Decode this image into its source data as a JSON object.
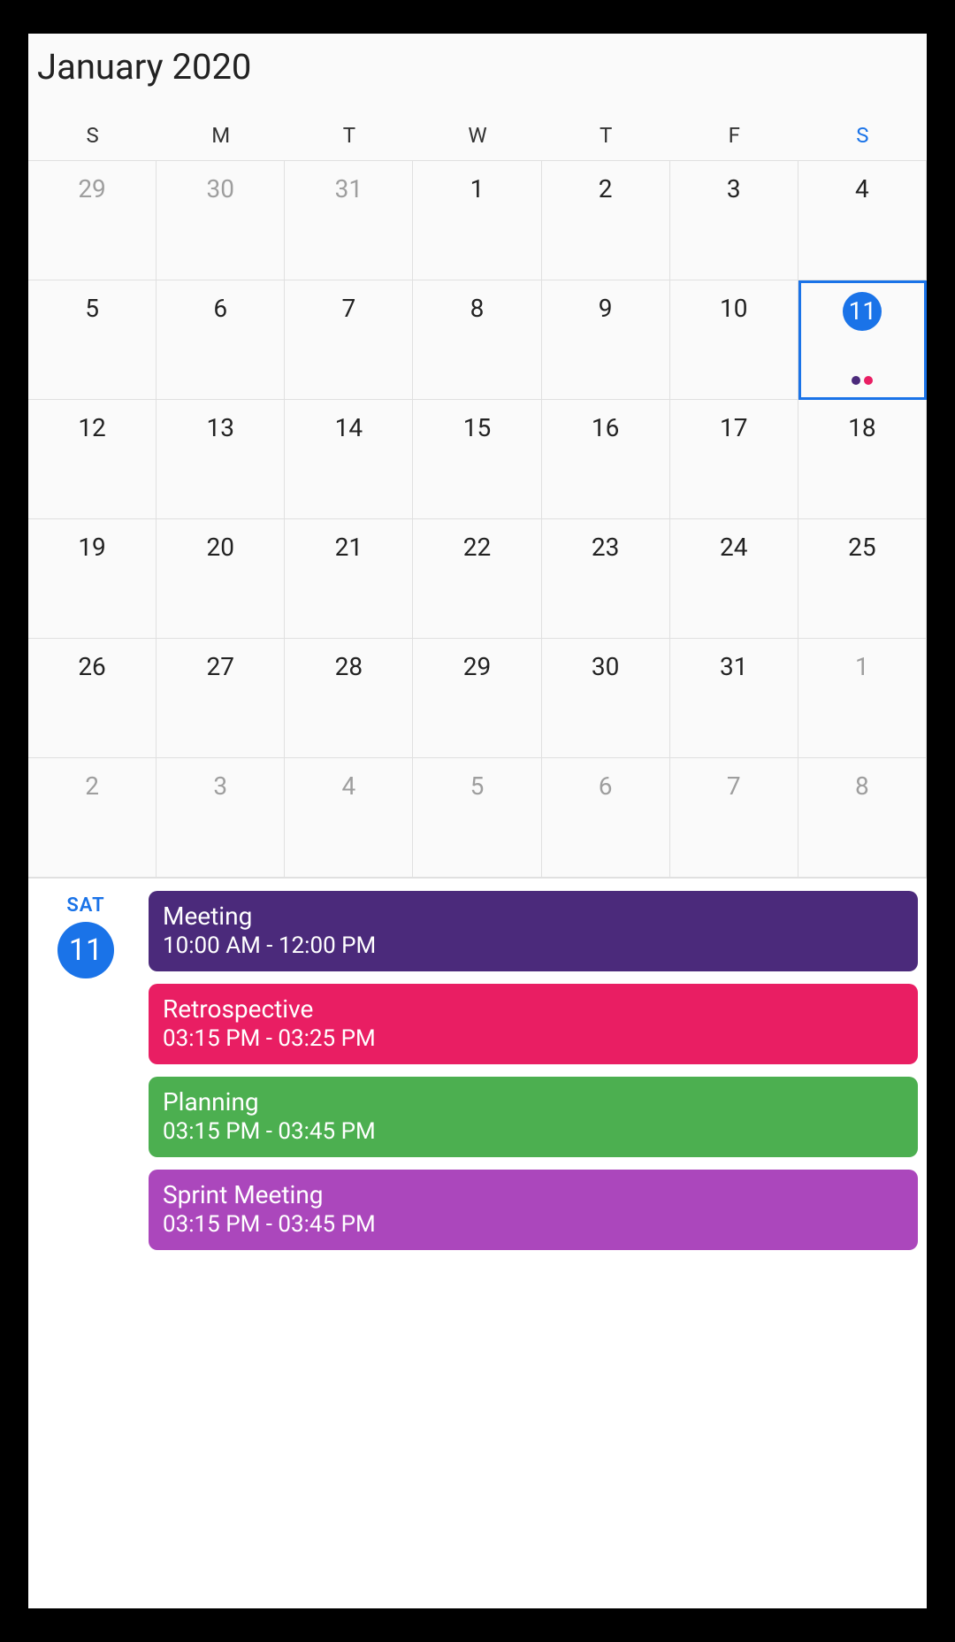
{
  "header": {
    "title": "January 2020"
  },
  "weekdays": [
    "S",
    "M",
    "T",
    "W",
    "T",
    "F",
    "S"
  ],
  "selected": {
    "row": 1,
    "col": 6
  },
  "grid": [
    [
      {
        "n": "29",
        "other": true
      },
      {
        "n": "30",
        "other": true
      },
      {
        "n": "31",
        "other": true
      },
      {
        "n": "1"
      },
      {
        "n": "2"
      },
      {
        "n": "3"
      },
      {
        "n": "4"
      }
    ],
    [
      {
        "n": "5"
      },
      {
        "n": "6"
      },
      {
        "n": "7"
      },
      {
        "n": "8"
      },
      {
        "n": "9"
      },
      {
        "n": "10"
      },
      {
        "n": "11",
        "selected": true,
        "dots": [
          "#4b2a7b",
          "#e91e63"
        ]
      }
    ],
    [
      {
        "n": "12"
      },
      {
        "n": "13"
      },
      {
        "n": "14"
      },
      {
        "n": "15"
      },
      {
        "n": "16"
      },
      {
        "n": "17"
      },
      {
        "n": "18"
      }
    ],
    [
      {
        "n": "19"
      },
      {
        "n": "20"
      },
      {
        "n": "21"
      },
      {
        "n": "22"
      },
      {
        "n": "23"
      },
      {
        "n": "24"
      },
      {
        "n": "25"
      }
    ],
    [
      {
        "n": "26"
      },
      {
        "n": "27"
      },
      {
        "n": "28"
      },
      {
        "n": "29"
      },
      {
        "n": "30"
      },
      {
        "n": "31"
      },
      {
        "n": "1",
        "other": true
      }
    ],
    [
      {
        "n": "2",
        "other": true
      },
      {
        "n": "3",
        "other": true
      },
      {
        "n": "4",
        "other": true
      },
      {
        "n": "5",
        "other": true
      },
      {
        "n": "6",
        "other": true
      },
      {
        "n": "7",
        "other": true
      },
      {
        "n": "8",
        "other": true
      }
    ]
  ],
  "agenda": {
    "day_label": "SAT",
    "day_number": "11",
    "events": [
      {
        "title": "Meeting",
        "time": "10:00 AM - 12:00 PM",
        "color": "#4b2a7b"
      },
      {
        "title": "Retrospective",
        "time": "03:15 PM - 03:25 PM",
        "color": "#e91e63"
      },
      {
        "title": "Planning",
        "time": "03:15 PM - 03:45 PM",
        "color": "#4caf50"
      },
      {
        "title": "Sprint Meeting",
        "time": "03:15 PM - 03:45 PM",
        "color": "#ab47bc"
      }
    ]
  }
}
